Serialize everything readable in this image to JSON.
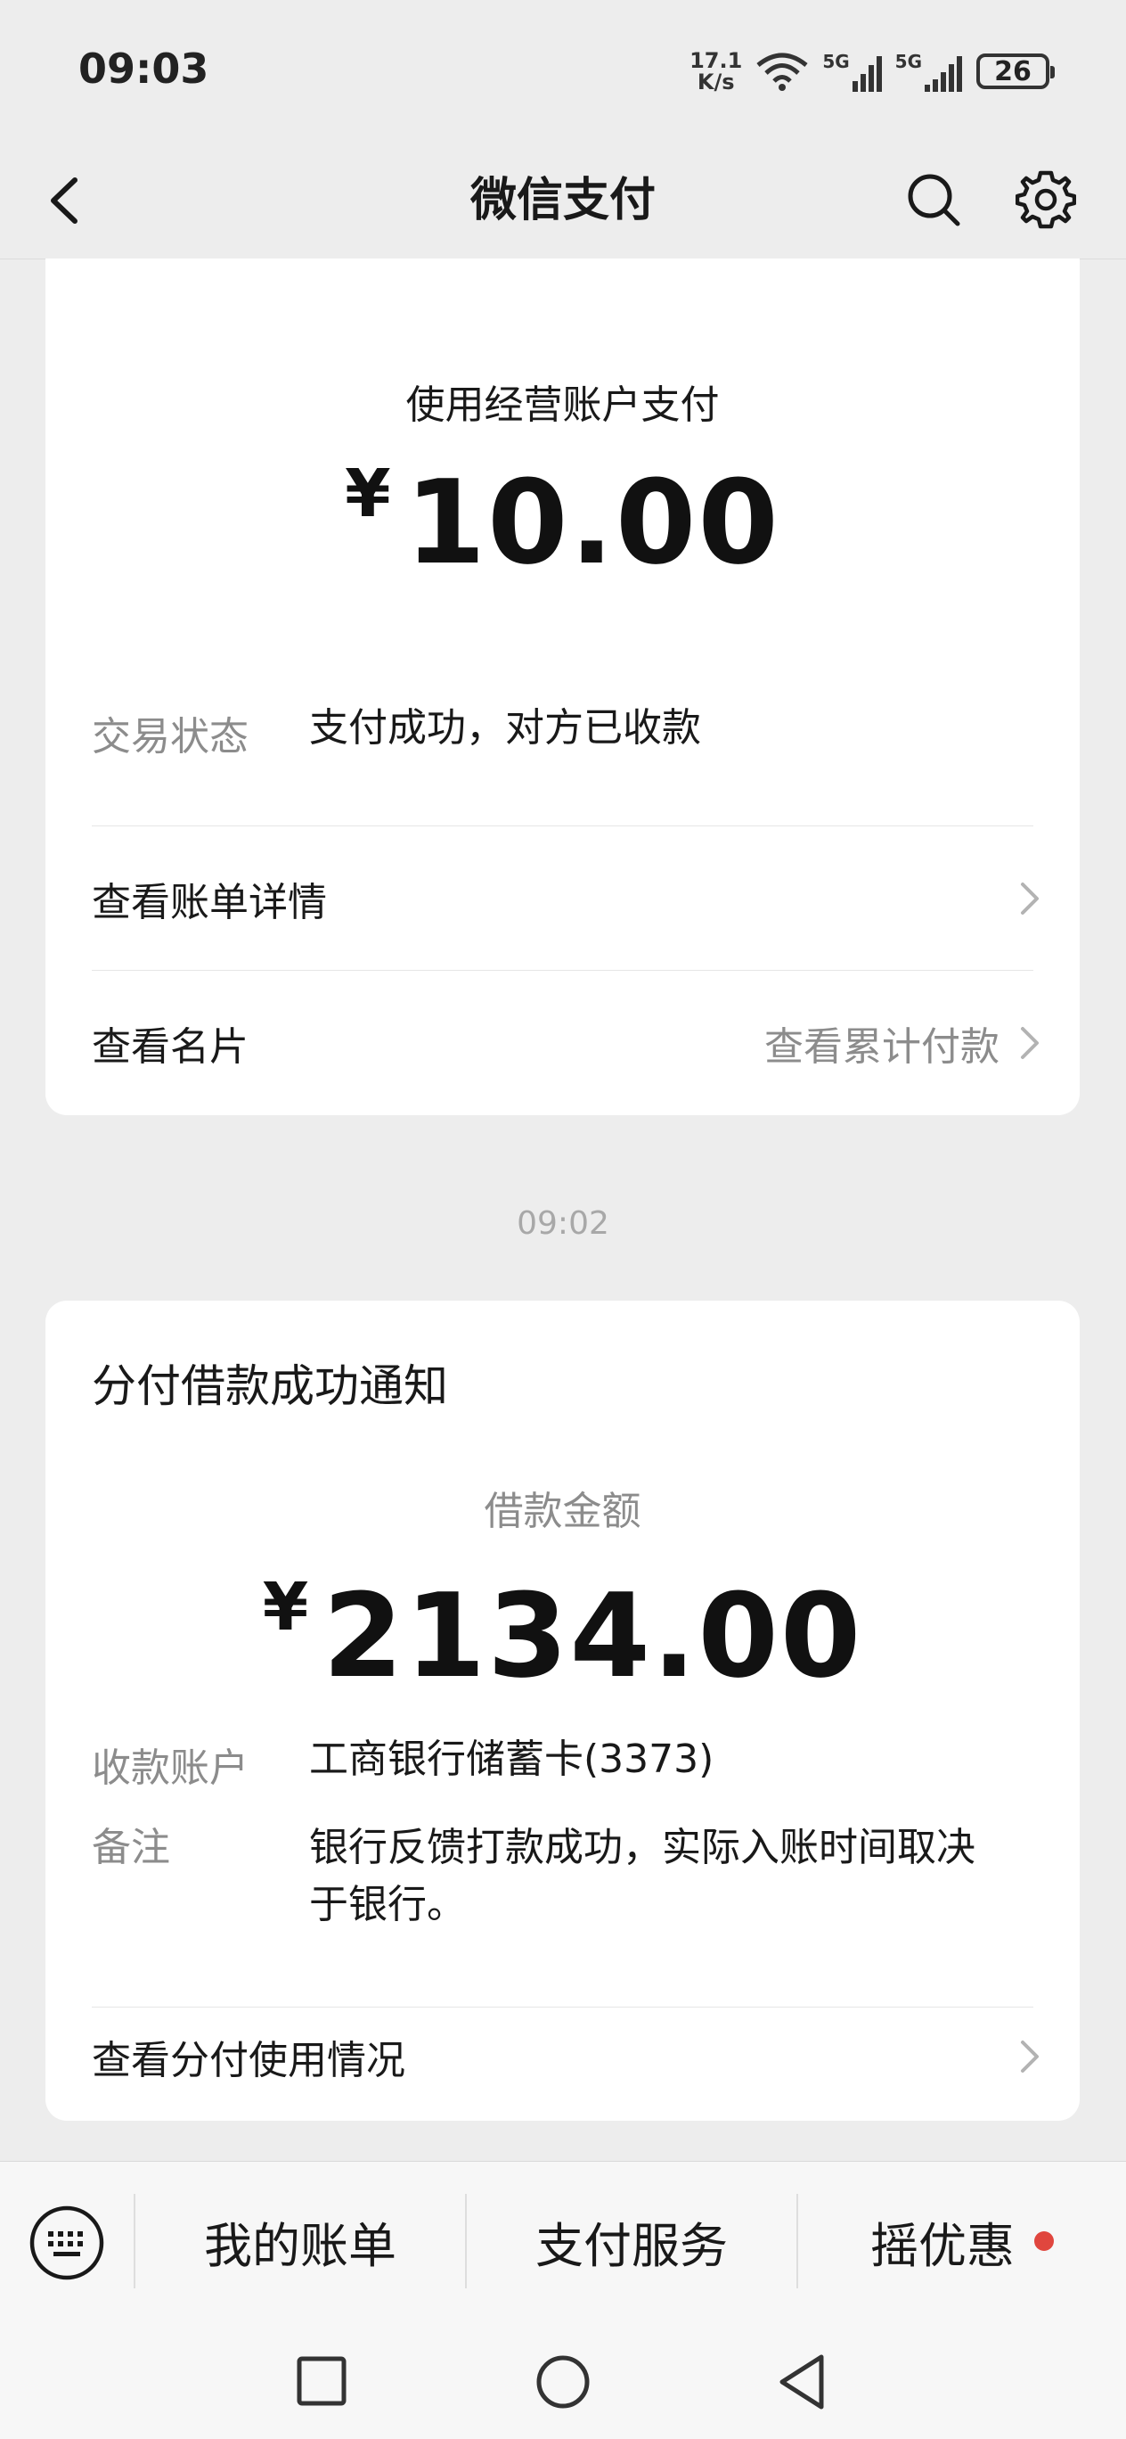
{
  "status_bar": {
    "time": "09:03",
    "net_speed_value": "17.1",
    "net_speed_unit": "K/s",
    "signal1_label": "5G",
    "signal2_label": "5G",
    "battery_level": "26"
  },
  "nav": {
    "title": "微信支付"
  },
  "payment_card": {
    "label": "使用经营账户支付",
    "currency_symbol": "¥",
    "amount": "10.00",
    "status_key": "交易状态",
    "status_value": "支付成功，对方已收款",
    "bill_detail_label": "查看账单详情",
    "card_label": "查看名片",
    "cumulative_label": "查看累计付款"
  },
  "timestamp": "09:02",
  "loan_card": {
    "title": "分付借款成功通知",
    "amount_label": "借款金额",
    "currency_symbol": "¥",
    "amount": "2134.00",
    "account_key": "收款账户",
    "account_value": "工商银行储蓄卡(3373)",
    "remark_key": "备注",
    "remark_value_line1": "银行反馈打款成功，实际入账时间取决",
    "remark_value_line2": "于银行。",
    "usage_label": "查看分付使用情况"
  },
  "bottom_menu": {
    "items": [
      {
        "label": "我的账单"
      },
      {
        "label": "支付服务"
      },
      {
        "label": "摇优惠"
      }
    ],
    "dot_color": "#e0463e"
  }
}
